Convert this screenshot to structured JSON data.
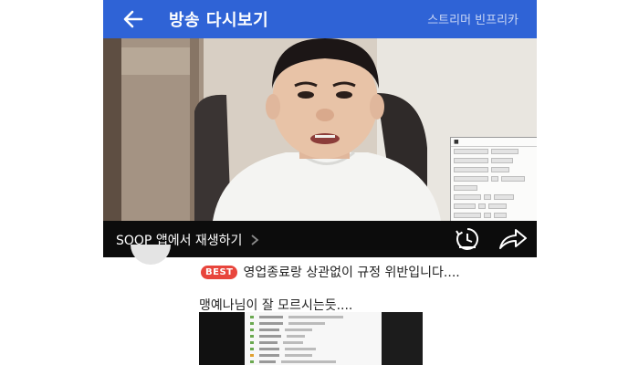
{
  "header": {
    "title": "방송 다시보기",
    "streamer": "스트리머 빈프리카"
  },
  "playbar": {
    "play_in_app_label": "SOOP 앱에서 재생하기"
  },
  "post": {
    "badge": "BEST",
    "title": "영업종료랑 상관없이 규정 위반입니다....",
    "description": "맹예나님이 잘 모르시는듯...."
  },
  "colors": {
    "header_bg": "#2f63d6",
    "playbar_bg": "#0c0c0c",
    "badge_bg": "#e8453c"
  },
  "icons": {
    "back": "arrow-left-icon",
    "chevron": "chevron-right-icon",
    "replay": "replay-clock-icon",
    "share": "share-arrow-icon"
  }
}
